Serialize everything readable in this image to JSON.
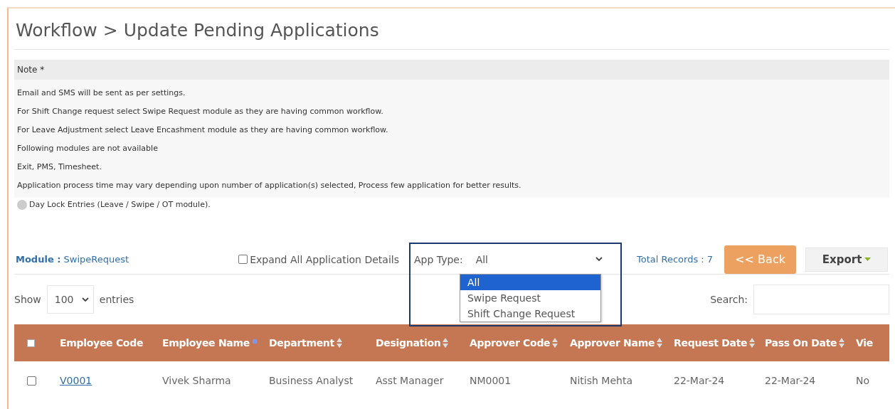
{
  "page": {
    "title": "Workflow > Update Pending Applications"
  },
  "note": {
    "heading": "Note *",
    "lines": [
      "Email and SMS will be sent as per settings.",
      "For Shift Change request select Swipe Request module as they are having common workflow.",
      "For Leave Adjustment select Leave Encashment module as they are having common workflow.",
      "Following modules are not available",
      "Exit, PMS, Timesheet.",
      "Application process time may vary depending upon number of application(s) selected, Process few application for better results."
    ],
    "legend": {
      "label": "Day Lock Entries (Leave / Swipe / OT module).",
      "color": "#cccccc"
    }
  },
  "toolbar": {
    "module_label": "Module :",
    "module_value": "SwipeRequest",
    "expand_label": "Expand All Application Details",
    "expand_checked": false,
    "app_type_label": "App Type:",
    "app_type_value": "All",
    "app_type_expanded": true,
    "app_type_options": [
      {
        "label": "All",
        "selected": true
      },
      {
        "label": "Swipe Request",
        "selected": false
      },
      {
        "label": "Shift Change Request",
        "selected": false
      }
    ],
    "total_records": "Total Records : 7",
    "back_button": "<< Back",
    "export_button": "Export"
  },
  "table_controls": {
    "show_label": "Show",
    "page_size": "100",
    "entries_label": "entries",
    "search_label": "Search:"
  },
  "table": {
    "header_checked": false,
    "columns": [
      {
        "label": "Employee Code",
        "sortable": false,
        "sorted": false
      },
      {
        "label": "Employee Name",
        "sortable": true,
        "sorted": true
      },
      {
        "label": "Department",
        "sortable": true,
        "sorted": false
      },
      {
        "label": "Designation",
        "sortable": true,
        "sorted": false
      },
      {
        "label": "Approver Code",
        "sortable": true,
        "sorted": false
      },
      {
        "label": "Approver Name",
        "sortable": true,
        "sorted": false
      },
      {
        "label": "Request Date",
        "sortable": true,
        "sorted": false
      },
      {
        "label": "Pass On Date",
        "sortable": true,
        "sorted": false
      },
      {
        "label": "Vie",
        "sortable": false,
        "sorted": false
      }
    ],
    "rows": [
      {
        "checked": false,
        "cells": [
          "V0001",
          "Vivek Sharma",
          "Business Analyst",
          "Asst Manager",
          "NM0001",
          "Nitish Mehta",
          "22-Mar-24",
          "22-Mar-24",
          "No"
        ]
      }
    ]
  }
}
